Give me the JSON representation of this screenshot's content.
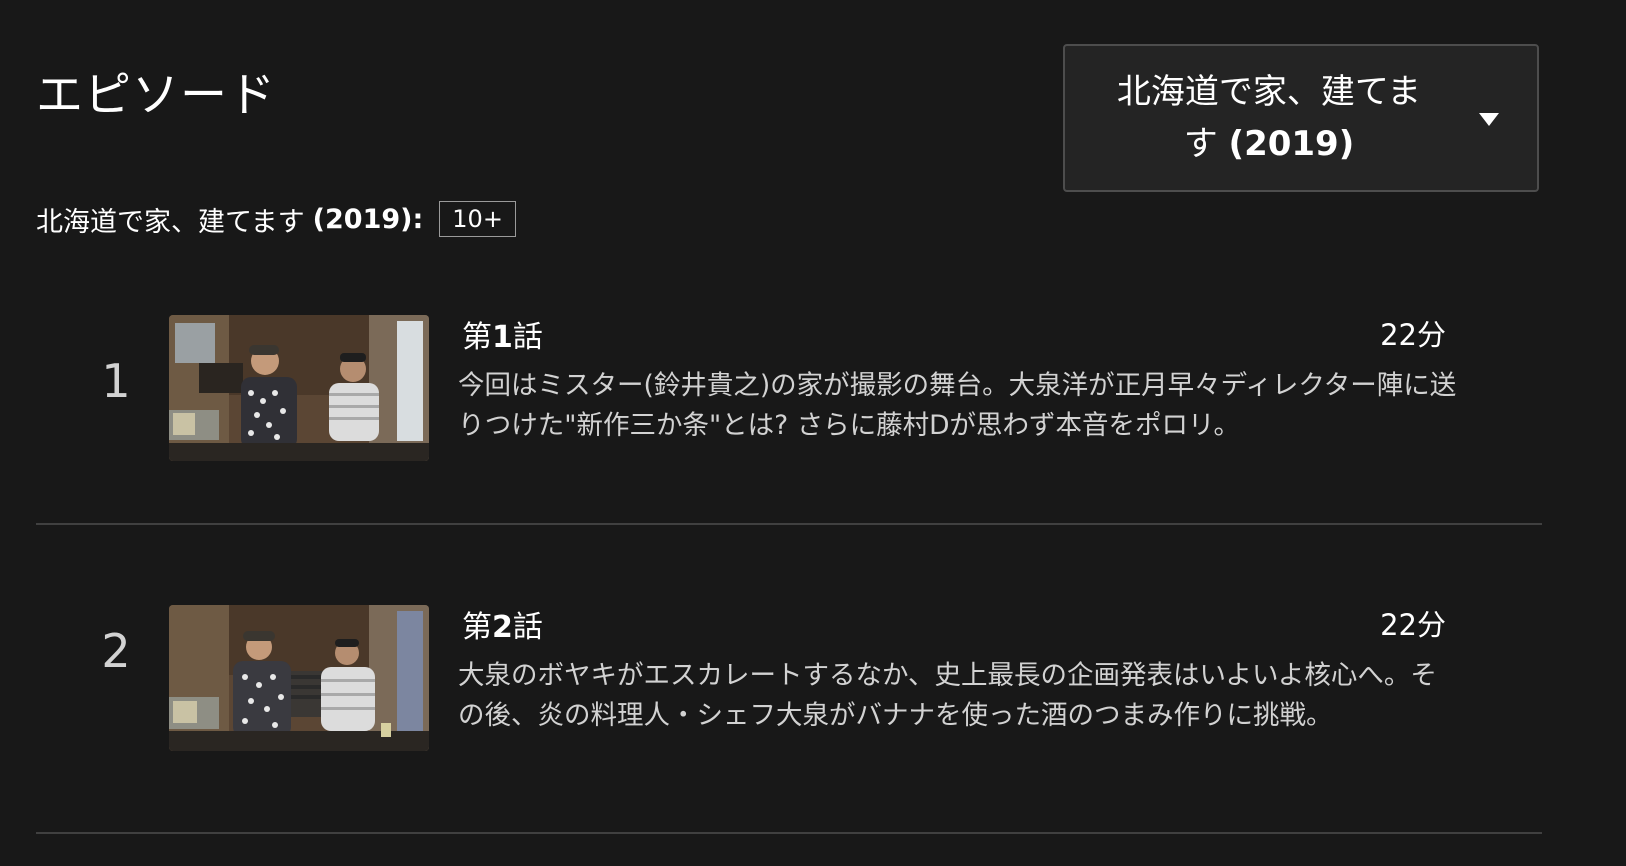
{
  "header": {
    "title": "エピソード"
  },
  "season_selector": {
    "line1": "北海道で家、建てま",
    "line2_prefix": "す ",
    "line2_year": "(2019)",
    "caret_icon": "caret-down-icon"
  },
  "season_info": {
    "name": "北海道で家、建てます",
    "year": "(2019):",
    "rating": "10+"
  },
  "episodes": [
    {
      "index": "1",
      "title_prefix": "第",
      "title_number": "1",
      "title_suffix": "話",
      "duration": "22分",
      "description": "今回はミスター(鈴井貴之)の家が撮影の舞台。大泉洋が正月早々ディレクター陣に送りつけた\"新作三か条\"とは? さらに藤村Dが思わず本音をポロリ。"
    },
    {
      "index": "2",
      "title_prefix": "第",
      "title_number": "2",
      "title_suffix": "話",
      "duration": "22分",
      "description": "大泉のボヤキがエスカレートするなか、史上最長の企画発表はいよいよ核心へ。その後、炎の料理人・シェフ大泉がバナナを使った酒のつまみ作りに挑戦。"
    }
  ],
  "colors": {
    "background": "#181818",
    "panel": "#242424",
    "border": "#4d4d4d",
    "divider": "#404040",
    "text_primary": "#ffffff",
    "text_secondary": "#d2d2d2"
  }
}
